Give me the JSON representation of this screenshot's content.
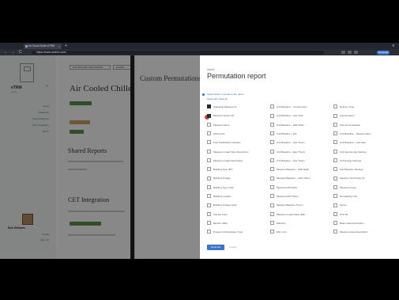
{
  "browser": {
    "tab_title": "ex Cloud Suite eTRM",
    "new_tab": "+",
    "window_close": "x",
    "back": "←",
    "forward": "→",
    "reload": "C",
    "url": "https://www.acehm.com/",
    "profile": "Personal"
  },
  "sidebar": {
    "brand": "eTRM",
    "brand_sub": "acehm",
    "collapse": "«",
    "links": [
      "Home",
      "Measures",
      "Shared Reports",
      "CET Integration",
      "Admin"
    ],
    "user_name": "Bob Williams",
    "user_links": [
      "Profile",
      "Sign out"
    ]
  },
  "main": {
    "page_title": "Air Cooled Chillers",
    "shared_reports_heading": "Shared Reports",
    "cet_heading": "CET Integration",
    "top_buttons": [
      "ADD MEASURE / NEW VERSION",
      "EXPORT"
    ]
  },
  "mid_panel": {
    "title": "Custom Permutations"
  },
  "modal": {
    "kicker": "report",
    "title": "Permutation report",
    "info_line1": "Select fields to include in the report",
    "info_line2": "Select all  |  Clear all",
    "generate_label": "Generate",
    "cancel_label": "Cancel",
    "columns": [
      [
        "Statewide Measure ID",
        "Measure Version ID",
        "Measure Name",
        "Offering ID",
        "Fuel Substitution Indicator",
        "Measure Impact Type Description",
        "Measure Impact Description",
        "Building Type (BT)",
        "Building Vintage",
        "Building Type Code",
        "Building Location",
        "Building Vintage Code",
        "Climate Zone",
        "Electric Utility",
        "Program Administrator Type"
      ],
      [
        "Unit Baseline – Consumption",
        "Unit Baseline – Gas Cost",
        "Unit Baseline – kWh Ratio",
        "Unit Baseline – kW",
        "Unit Baseline – Gas Therm",
        "Unit Baseline – Elec Therm",
        "Unit Baseline – Gas Therm",
        "Measure Baseline – kWh Ratio",
        "Measure Baseline – kWh Therm",
        "Measure kWh Ratio",
        "Measure kWh Therm",
        "Measure Baseline Therm",
        "Measure Impact Ratio (ER)",
        "Effective",
        "EUL (yrs)"
      ],
      [
        "Delivery Type",
        "Gas Emission",
        "Gas Gross Kilowatt",
        "Unit Baseline – Measure Elec",
        "Unit Baseline – Gas Elec",
        "Unit Gas Energy Savings",
        "Unit Energy Savings",
        "Gas Baseline Savings",
        "Measure Technology ID",
        "Measure Group",
        "Normalizing Unit",
        "Sector",
        "NTG ID",
        "Base Case Description",
        "Measure Case Description"
      ]
    ],
    "checked": [
      0,
      1
    ]
  }
}
